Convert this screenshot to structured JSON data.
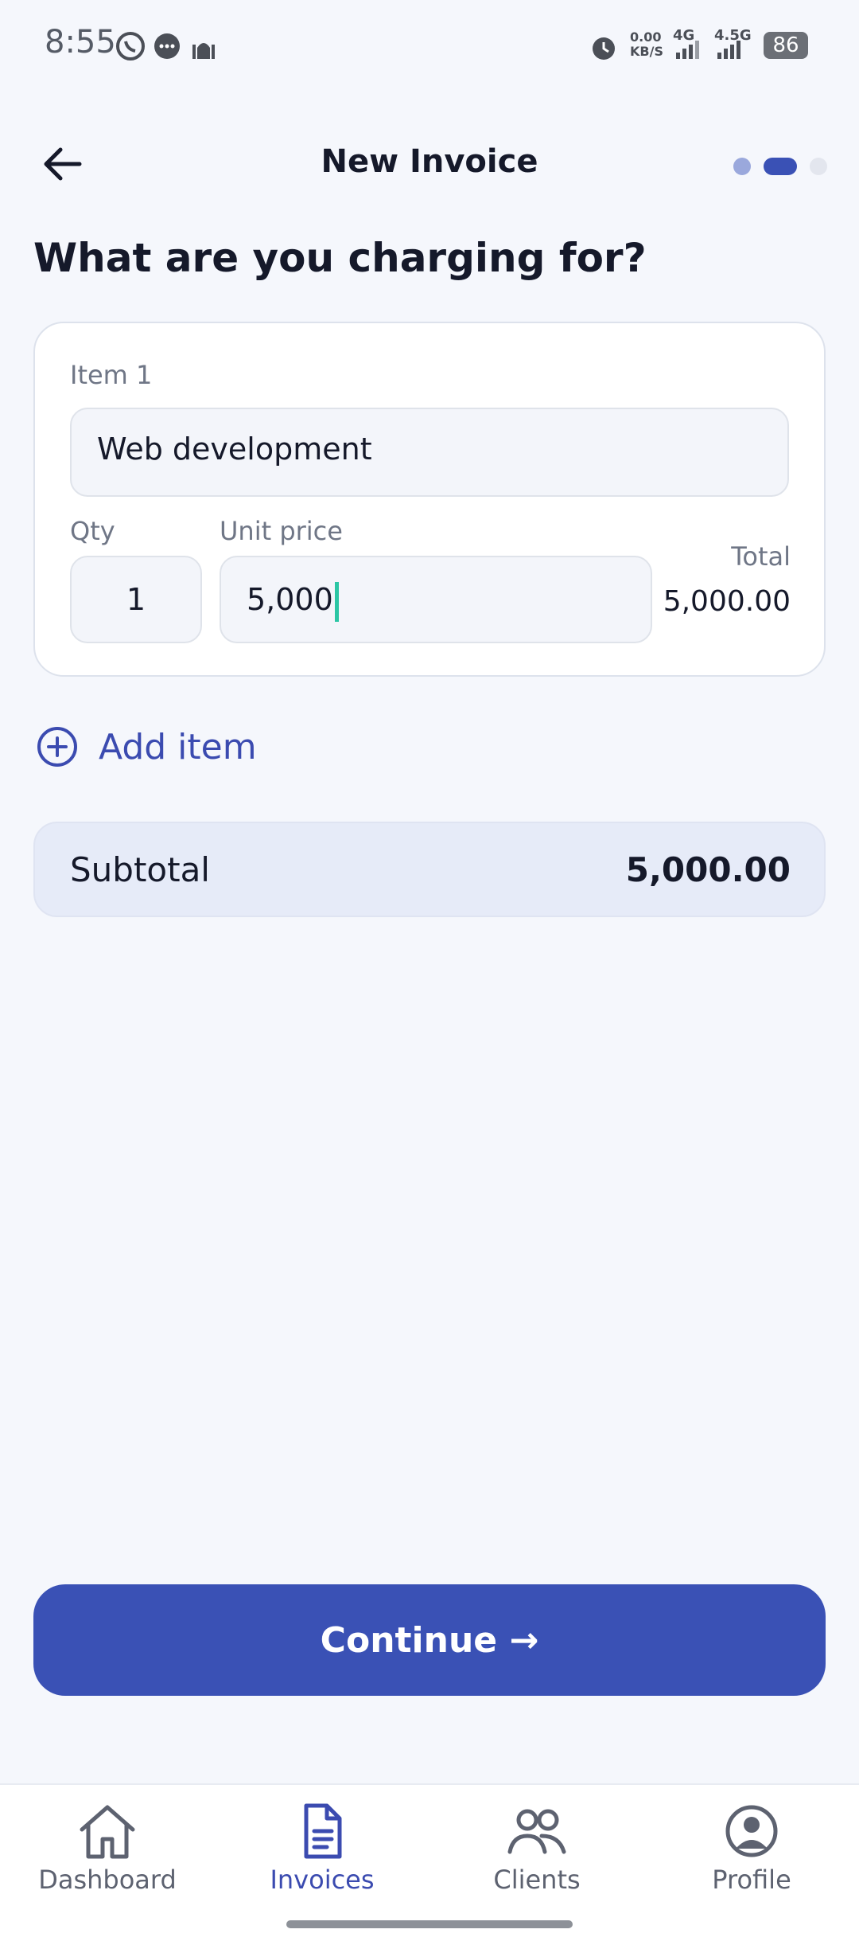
{
  "status_bar": {
    "time": "8:55",
    "network_speed": "0.00\nKB/S",
    "net1": "4G",
    "net2": "4.5G",
    "battery": "86"
  },
  "header": {
    "title": "New Invoice",
    "step_dots": [
      "inactive",
      "active",
      "upcoming"
    ]
  },
  "question": "What are you charging for?",
  "item": {
    "label": "Item 1",
    "description": "Web development",
    "qty_label": "Qty",
    "qty": "1",
    "unit_price_label": "Unit price",
    "unit_price": "5,000",
    "total_label": "Total",
    "total": "5,000.00"
  },
  "add_item_label": "Add item",
  "subtotal": {
    "label": "Subtotal",
    "value": "5,000.00"
  },
  "continue_label": "Continue →",
  "nav": [
    {
      "label": "Dashboard",
      "icon": "home-icon",
      "active": false
    },
    {
      "label": "Invoices",
      "icon": "document-icon",
      "active": true
    },
    {
      "label": "Clients",
      "icon": "people-icon",
      "active": false
    },
    {
      "label": "Profile",
      "icon": "profile-icon",
      "active": false
    }
  ],
  "colors": {
    "accent": "#3a51b5",
    "background": "#f5f7fc",
    "nav_active": "#3b4bb0",
    "nav_inactive": "#5d6270"
  }
}
